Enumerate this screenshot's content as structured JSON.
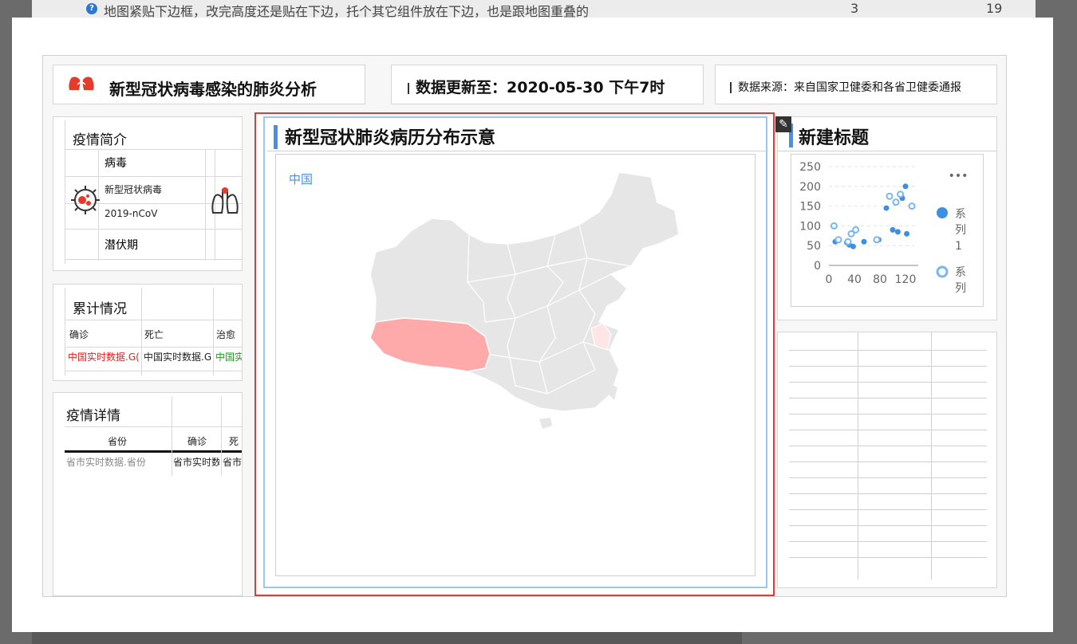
{
  "background": {
    "question_text": "地图紧贴下边框，改完高度还是贴在下边，托个其它组件放在下边，也是跟地图重叠的",
    "col_a": "3",
    "col_b": "19"
  },
  "header": {
    "title": "新型冠状病毒感染的肺炎分析",
    "update": "数据更新至：2020-05-30 下午7时",
    "source": "数据来源：来自国家卫健委和各省卫健委通报"
  },
  "intro": {
    "title": "疫情简介",
    "virus_label": "病毒",
    "virus_name": "新型冠状病毒",
    "virus_code": "2019-nCoV",
    "incubation": "潜伏期"
  },
  "cumulative": {
    "title": "累计情况",
    "headers": [
      "确诊",
      "死亡",
      "治愈"
    ],
    "values": [
      "中国实时数据.G(",
      "中国实时数据.G(TotalDead)",
      "中国实时数据.G(To"
    ]
  },
  "detail": {
    "title": "疫情详情",
    "headers": [
      "省份",
      "确诊",
      "死"
    ],
    "cells": [
      "省市实时数据.省份",
      "省市实时数据.确",
      "省市实时数据.死"
    ]
  },
  "map": {
    "title": "新型冠状肺炎病历分布示意",
    "label": "中国",
    "colors": {
      "base": "#e6e6e6",
      "high": "#ffaaaa",
      "low": "#ffe5e5",
      "border": "#ffffff"
    }
  },
  "scatter_panel": {
    "title": "新建标题",
    "edit_icon": "edit-icon",
    "more_icon": "more-icon",
    "legend": [
      "系列1",
      "系列"
    ]
  },
  "chart_data": {
    "type": "scatter",
    "xlim": [
      0,
      140
    ],
    "ylim": [
      0,
      250
    ],
    "x_ticks": [
      "0",
      "40",
      "80",
      "120"
    ],
    "y_ticks": [
      "0",
      "50",
      "100",
      "150",
      "200",
      "250"
    ],
    "legend_placement": "right",
    "series": [
      {
        "name": "系列1",
        "filled": true,
        "color": "#3d8fe0",
        "points": [
          [
            10,
            60
          ],
          [
            28,
            58
          ],
          [
            32,
            52
          ],
          [
            38,
            48
          ],
          [
            55,
            60
          ],
          [
            78,
            65
          ],
          [
            90,
            145
          ],
          [
            100,
            90
          ],
          [
            108,
            85
          ],
          [
            115,
            170
          ],
          [
            120,
            200
          ],
          [
            122,
            80
          ]
        ]
      },
      {
        "name": "系列",
        "filled": false,
        "color": "#3d8fe0",
        "points": [
          [
            8,
            100
          ],
          [
            15,
            65
          ],
          [
            30,
            60
          ],
          [
            35,
            80
          ],
          [
            42,
            90
          ],
          [
            75,
            65
          ],
          [
            95,
            175
          ],
          [
            105,
            160
          ],
          [
            112,
            180
          ],
          [
            130,
            150
          ]
        ]
      }
    ]
  }
}
